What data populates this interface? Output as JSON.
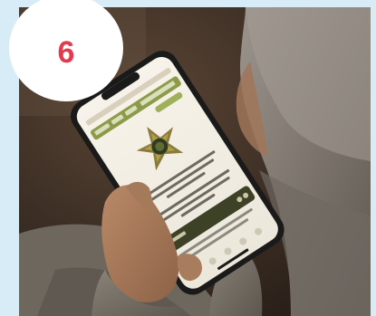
{
  "step_badge": {
    "number": "6"
  },
  "photo": {
    "subject": "person-holding-phone"
  },
  "colors": {
    "background": "#d7ecf6",
    "badge_fill": "#ffffff",
    "badge_number": "#e43a4e",
    "app_accent": "#8c9a4a"
  }
}
